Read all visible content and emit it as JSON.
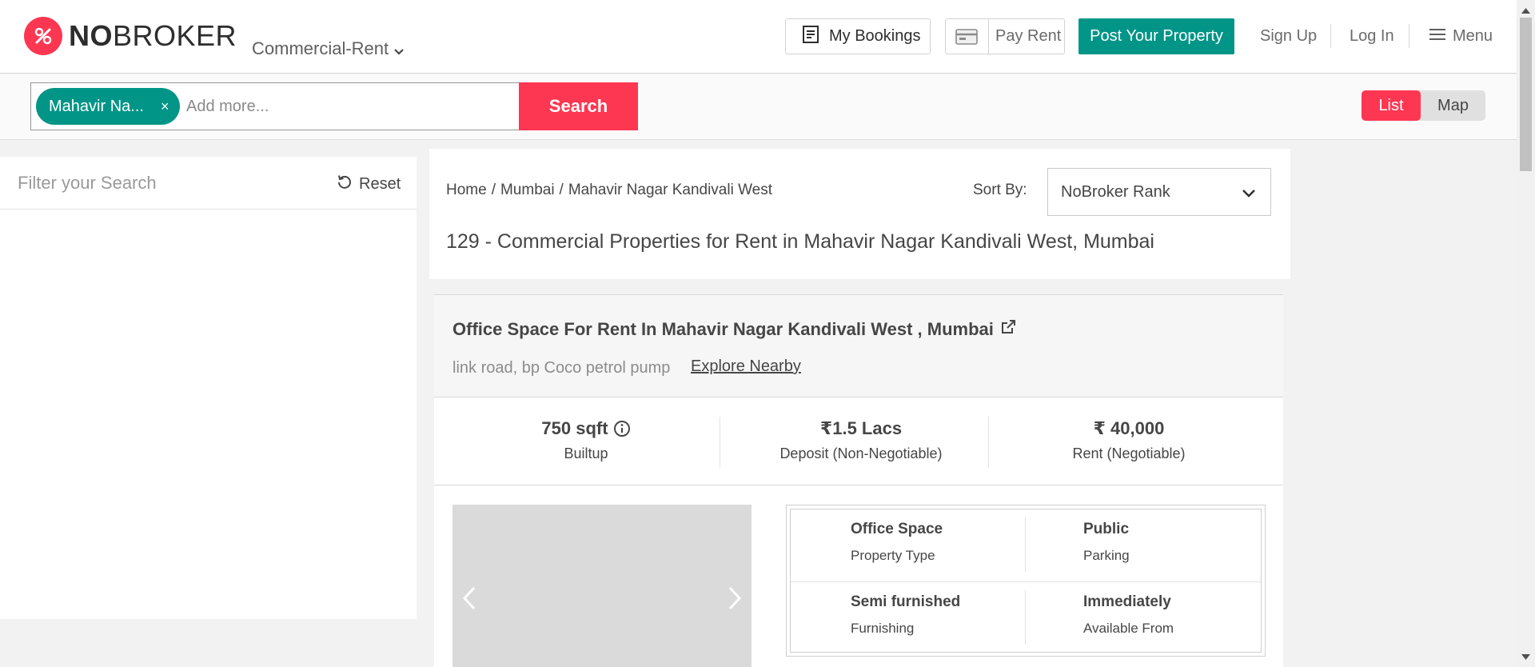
{
  "header": {
    "logo": {
      "bold": "NO",
      "regular": "BROKER"
    },
    "category": "Commercial-Rent",
    "my_bookings": "My Bookings",
    "pay_rent": "Pay Rent",
    "post_property": "Post Your Property",
    "sign_up": "Sign Up",
    "log_in": "Log In",
    "menu": "Menu"
  },
  "search": {
    "chip_label": "Mahavir Na...",
    "chip_close": "×",
    "placeholder": "Add more...",
    "button": "Search",
    "view_list": "List",
    "view_map": "Map"
  },
  "filter": {
    "title": "Filter your Search",
    "reset": "Reset"
  },
  "results": {
    "breadcrumb": [
      "Home",
      "Mumbai",
      "Mahavir Nagar Kandivali West"
    ],
    "sort_label": "Sort By:",
    "sort_value": "NoBroker Rank",
    "title": "129 - Commercial Properties for Rent in Mahavir Nagar Kandivali West, Mumbai"
  },
  "property": {
    "title": "Office Space For Rent In Mahavir Nagar Kandivali West , Mumbai",
    "address": "link road, bp Coco petrol pump",
    "explore": "Explore Nearby",
    "stats": [
      {
        "value": "750 sqft",
        "label": "Builtup"
      },
      {
        "value": "₹1.5 Lacs",
        "label": "Deposit (Non-Negotiable)"
      },
      {
        "value": "₹ 40,000",
        "label": "Rent (Negotiable)"
      }
    ],
    "details": [
      {
        "value": "Office Space",
        "label": "Property Type"
      },
      {
        "value": "Public",
        "label": "Parking"
      },
      {
        "value": "Semi furnished",
        "label": "Furnishing"
      },
      {
        "value": "Immediately",
        "label": "Available From"
      }
    ]
  },
  "colors": {
    "brand_red": "#fd3752",
    "brand_teal": "#009587"
  }
}
